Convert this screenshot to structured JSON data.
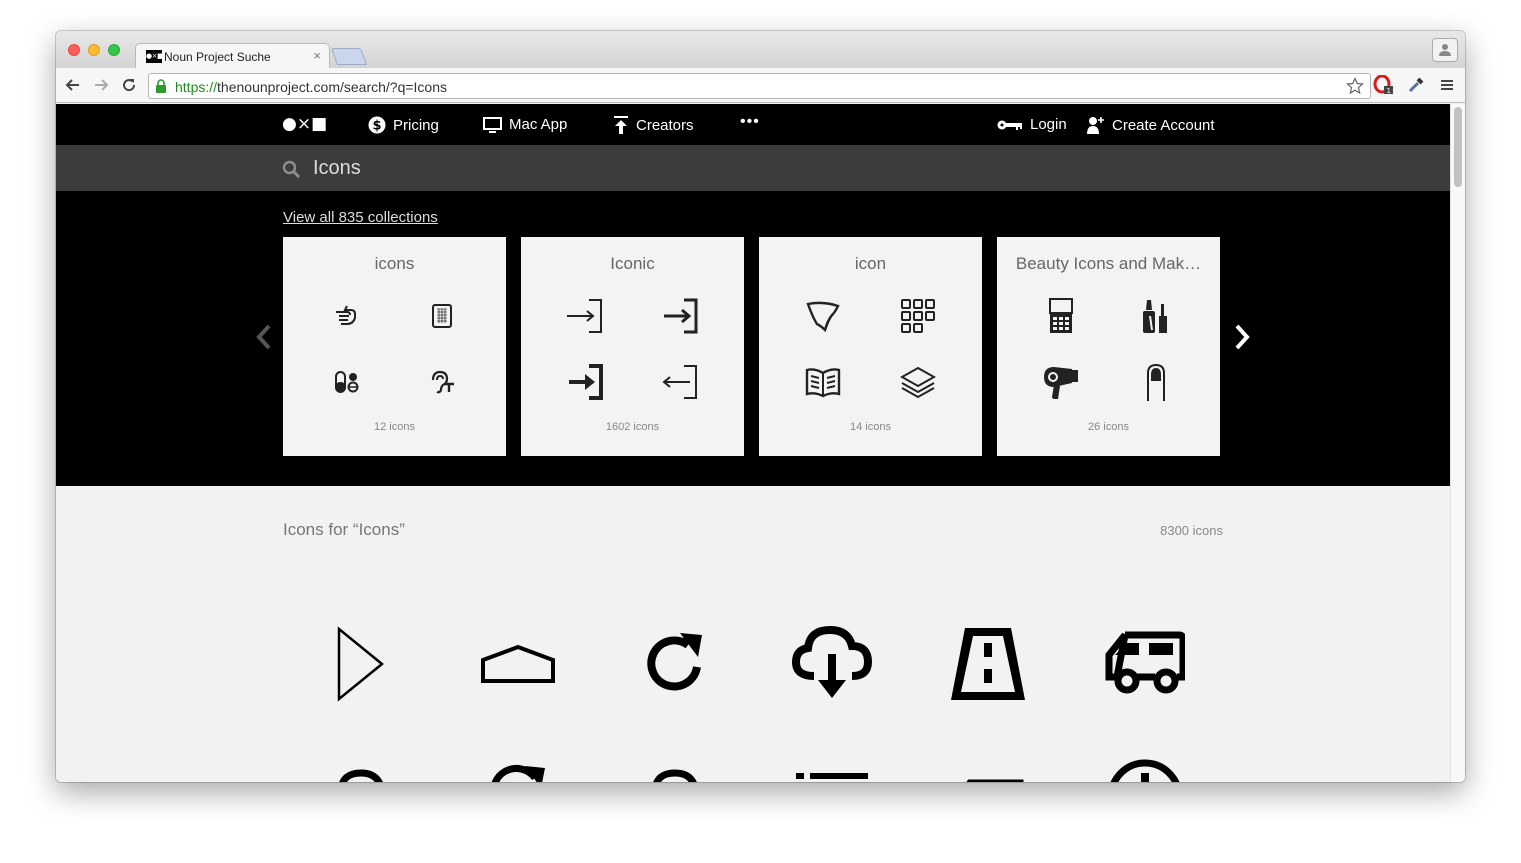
{
  "browser": {
    "tab_title": "Noun Project Suche",
    "tab_favicon_text": "●×■",
    "tab_close": "×",
    "url_scheme": "https://",
    "url_rest": "thenounproject.com/search/?q=Icons"
  },
  "nav": {
    "logo": "●×■",
    "pricing": "Pricing",
    "mac_app": "Mac App",
    "creators": "Creators",
    "more": "•••",
    "login": "Login",
    "create_account": "Create Account"
  },
  "search": {
    "query": "Icons"
  },
  "collections": {
    "view_all": "View all 835 collections",
    "cards": [
      {
        "title": "icons",
        "count": "12 icons",
        "icons": [
          "pointing-hand-icon",
          "tablet-icon",
          "pills-icon",
          "hearing-icon"
        ]
      },
      {
        "title": "Iconic",
        "count": "1602 icons",
        "icons": [
          "login-arrow-icon",
          "login-arrow-icon",
          "login-arrow-bold-icon",
          "logout-arrow-icon"
        ]
      },
      {
        "title": "icon",
        "count": "14 icons",
        "icons": [
          "shield-shape-icon",
          "grid-icon",
          "open-book-icon",
          "layers-icon"
        ]
      },
      {
        "title": "Beauty Icons and Mak…",
        "count": "26 icons",
        "icons": [
          "compact-icon",
          "nail-polish-icon",
          "hair-dryer-icon",
          "nail-icon"
        ]
      }
    ]
  },
  "results": {
    "title": "Icons for “Icons”",
    "count": "8300 icons",
    "icons": [
      "play-outline-icon",
      "home-outline-icon",
      "refresh-icon",
      "cloud-download-icon",
      "road-icon",
      "truck-icon",
      "cloud-icon",
      "refresh-icon",
      "cloud-icon",
      "list-icon",
      "road-icon",
      "clock-icon"
    ]
  }
}
